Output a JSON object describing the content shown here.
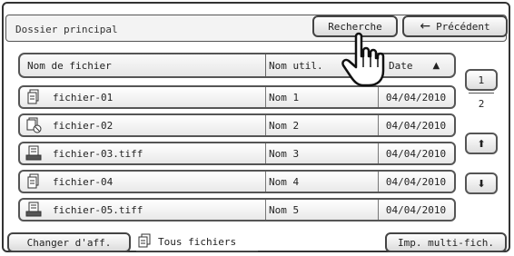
{
  "header": {
    "folder_title": "Dossier principal",
    "search_label": "Recherche",
    "back_label": "Précédent"
  },
  "table": {
    "columns": [
      "Nom de fichier",
      "Nom util.",
      "Date"
    ],
    "rows": [
      {
        "icon": "document-icon",
        "name": "fichier-01",
        "user": "Nom 1",
        "date": "04/04/2010"
      },
      {
        "icon": "document-blocked-icon",
        "name": "fichier-02",
        "user": "Nom 2",
        "date": "04/04/2010"
      },
      {
        "icon": "scanned-image-icon",
        "name": "fichier-03.tiff",
        "user": "Nom 3",
        "date": "04/04/2010"
      },
      {
        "icon": "document-icon",
        "name": "fichier-04",
        "user": "Nom 4",
        "date": "04/04/2010"
      },
      {
        "icon": "scanned-image-icon",
        "name": "fichier-05.tiff",
        "user": "Nom 5",
        "date": "04/04/2010"
      }
    ]
  },
  "pager": {
    "current_page": "1",
    "total_pages": "2"
  },
  "footer": {
    "change_view_label": "Changer d'aff.",
    "filter_label": "Tous fichiers",
    "multi_print_label": "Imp. multi-fich."
  }
}
